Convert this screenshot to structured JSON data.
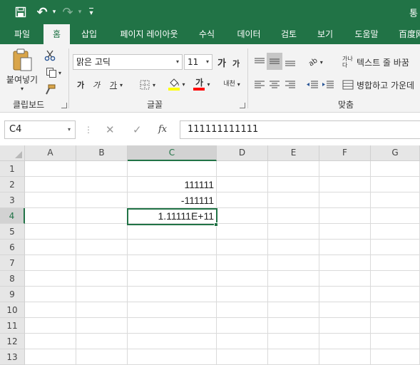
{
  "titlebar": {
    "title_partial": "통",
    "qat": {
      "save_icon": "save-icon",
      "undo_icon": "undo-icon",
      "redo_icon": "redo-icon",
      "customize_icon": "customize-qat-icon",
      "undo_glyph": "↶",
      "redo_glyph": "↷",
      "dropdown_glyph": "▾",
      "customize_glyph": "▾"
    }
  },
  "tabs": [
    {
      "label": "파일"
    },
    {
      "label": "홈"
    },
    {
      "label": "삽입"
    },
    {
      "label": "페이지 레이아웃"
    },
    {
      "label": "수식"
    },
    {
      "label": "데이터"
    },
    {
      "label": "검토"
    },
    {
      "label": "보기"
    },
    {
      "label": "도움말"
    },
    {
      "label": "百度网"
    }
  ],
  "active_tab": "홈",
  "ribbon": {
    "clipboard": {
      "label": "클립보드",
      "paste_label": "붙여넣기",
      "dropdown_glyph": "▾"
    },
    "font": {
      "label": "글꼴",
      "font_name": "맑은 고딕",
      "font_size": "11",
      "grow_label": "가",
      "shrink_label": "가",
      "bold_label": "가",
      "italic_label": "가",
      "underline_label": "가",
      "font_color_label": "가",
      "phonetic_label": "내천",
      "dropdown_glyph": "▾"
    },
    "alignment": {
      "label": "맞춤",
      "wrap_text_label": "텍스트 줄 바꿈",
      "merge_label": "병합하고 가운데",
      "orientation_label": "ab",
      "wrap_icon_label": "가나다"
    }
  },
  "formula_bar": {
    "name_box": "C4",
    "cancel_glyph": "✕",
    "enter_glyph": "✓",
    "fx_label": "fx",
    "dropdown_glyph": "▾",
    "divider_glyph": "⋮",
    "value": "111111111111"
  },
  "grid": {
    "columns": [
      "A",
      "B",
      "C",
      "D",
      "E",
      "F",
      "G"
    ],
    "rows": [
      "1",
      "2",
      "3",
      "4",
      "5",
      "6",
      "7",
      "8",
      "9",
      "10",
      "11",
      "12",
      "13"
    ],
    "selected_column": "C",
    "selected_row": "4",
    "cells": {
      "C2": "111111",
      "C3": "-111111",
      "C4": "1.11111E+11"
    }
  },
  "colors": {
    "accent": "#217346",
    "ribbon_bg": "#f3f3f3",
    "header_bg": "#e6e6e6",
    "fill_yellow": "#ffff00",
    "font_red": "#ff0000"
  }
}
